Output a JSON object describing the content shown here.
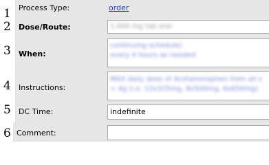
{
  "rows": [
    {
      "num": "1",
      "label": "Process Type:",
      "value": "order"
    },
    {
      "num": "2",
      "label": "Dose/Route:",
      "value": "1,000 mg tab oral"
    },
    {
      "num": "3",
      "label": "When:",
      "value_lines": [
        "continuing schedule)",
        "every 4 hours as needed"
      ]
    },
    {
      "num": "4",
      "label": "Instructions:",
      "value_lines": [
        "MAX daily dose of Acetaminophen from all s",
        "= 4g (i.e. 12x325mg, 8x500mg, 6x650mg)"
      ]
    },
    {
      "num": "5",
      "label": "DC Time:",
      "value": "indefinite"
    },
    {
      "num": "6",
      "label": "Comment:",
      "value": ""
    }
  ],
  "colors": {
    "row_background": "#e6e6e6",
    "link": "#1a3ea6",
    "field_border": "#a9a9a9"
  }
}
